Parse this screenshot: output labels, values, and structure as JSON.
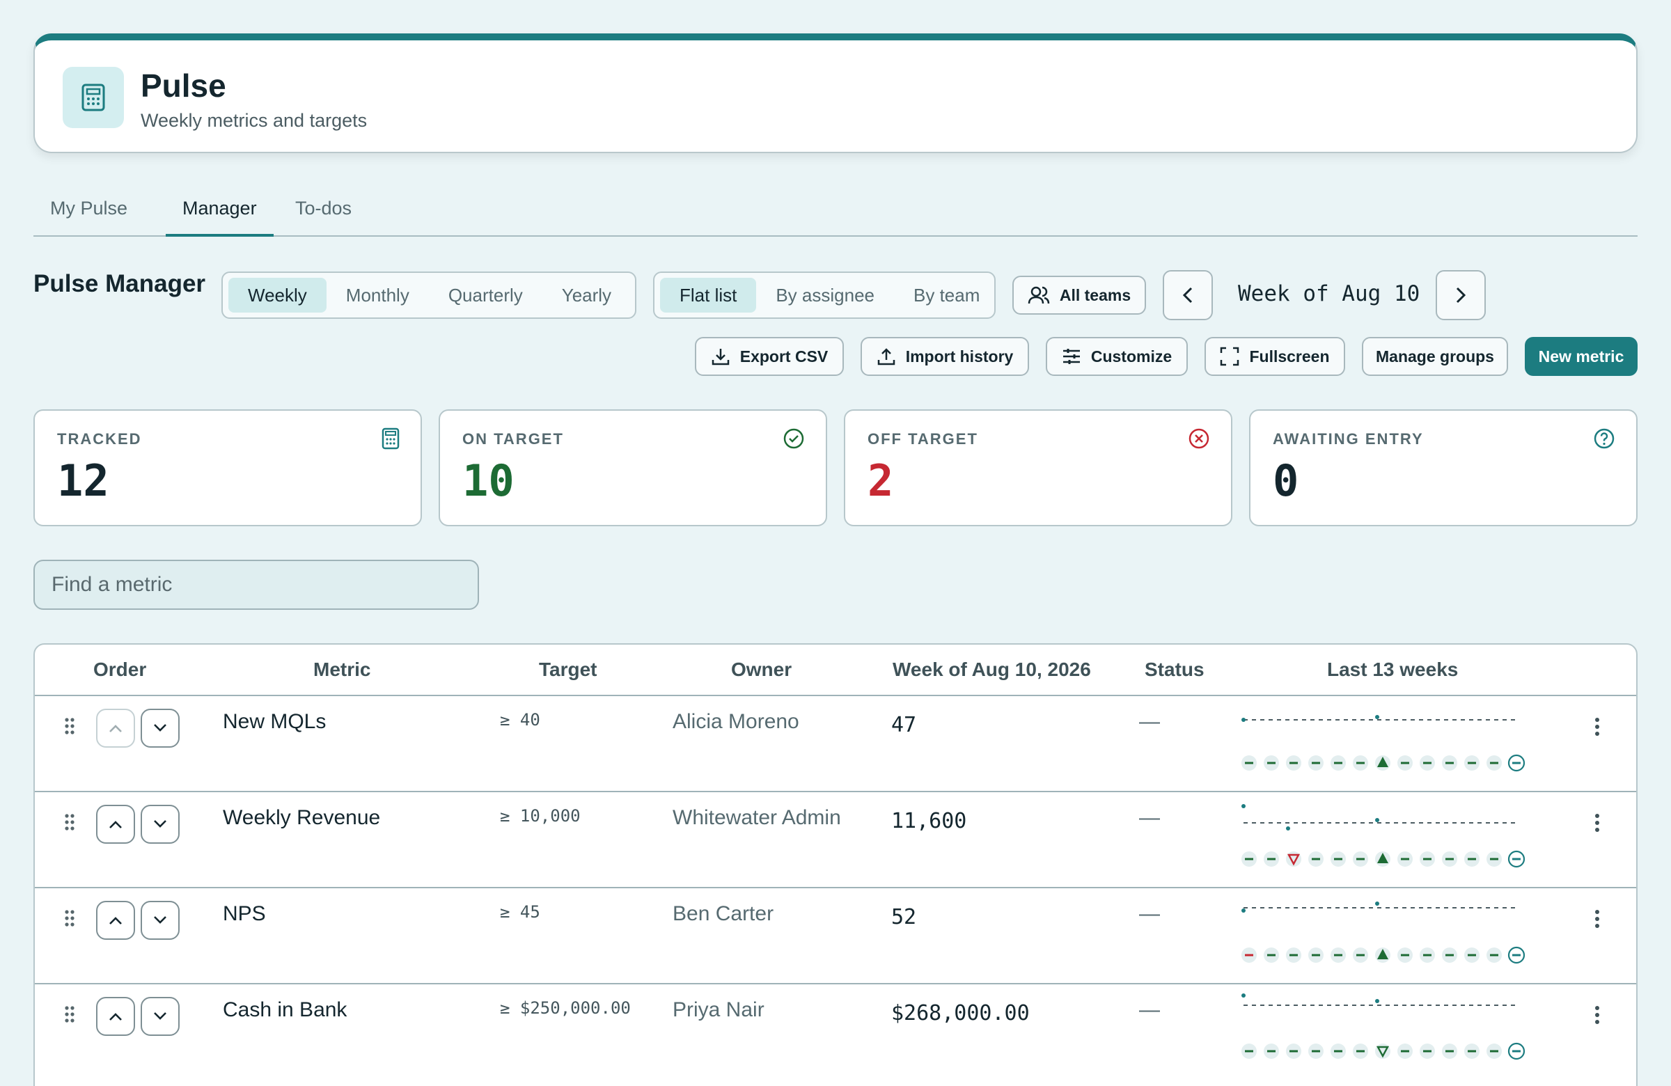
{
  "app": {
    "name": "Pulse",
    "subtitle": "Weekly metrics and targets",
    "icon": "calculator-icon"
  },
  "tabs": [
    {
      "label": "My Pulse",
      "active": false
    },
    {
      "label": "Manager",
      "active": true
    },
    {
      "label": "To-dos",
      "active": false
    }
  ],
  "page_title": "Pulse Manager",
  "periods": [
    {
      "label": "Weekly",
      "active": true
    },
    {
      "label": "Monthly",
      "active": false
    },
    {
      "label": "Quarterly",
      "active": false
    },
    {
      "label": "Yearly",
      "active": false
    }
  ],
  "views": [
    {
      "label": "Flat list",
      "active": true
    },
    {
      "label": "By assignee",
      "active": false
    },
    {
      "label": "By team",
      "active": false
    }
  ],
  "team_filter": {
    "label": "All teams",
    "icon": "users-icon"
  },
  "week_nav": {
    "label": "Week of Aug 10",
    "prev_icon": "chevron-left-icon",
    "next_icon": "chevron-right-icon"
  },
  "actions": {
    "export": "Export CSV",
    "import": "Import history",
    "customize": "Customize",
    "fullscreen": "Fullscreen",
    "manage_groups": "Manage groups",
    "new_metric": "New metric"
  },
  "stats": [
    {
      "label": "TRACKED",
      "value": "12",
      "icon": "calculator-icon",
      "color": "#14262e"
    },
    {
      "label": "ON TARGET",
      "value": "10",
      "icon": "check-circle-icon",
      "color": "#1d6b34"
    },
    {
      "label": "OFF TARGET",
      "value": "2",
      "icon": "x-circle-icon",
      "color": "#c62832"
    },
    {
      "label": "AWAITING ENTRY",
      "value": "0",
      "icon": "help-circle-icon",
      "color": "#14262e"
    }
  ],
  "search": {
    "placeholder": "Find a metric"
  },
  "table": {
    "headers": {
      "order": "Order",
      "metric": "Metric",
      "target": "Target",
      "owner": "Owner",
      "week": "Week of Aug 10, 2026",
      "status": "Status",
      "history": "Last 13 weeks"
    },
    "rows": [
      {
        "name": "New MQLs",
        "target": "≥ 40",
        "owner": "Alicia Moreno",
        "value": "47",
        "status": "—",
        "weeks": [
          "dash",
          "dash",
          "dash",
          "dash",
          "dash",
          "dash",
          "up",
          "dash",
          "dash",
          "dash",
          "dash",
          "dash",
          "current"
        ]
      },
      {
        "name": "Weekly Revenue",
        "target": "≥ 10,000",
        "owner": "Whitewater Admin",
        "value": "11,600",
        "status": "—",
        "weeks": [
          "dash",
          "dash",
          "down",
          "dash",
          "dash",
          "dash",
          "up",
          "dash",
          "dash",
          "dash",
          "dash",
          "dash",
          "current"
        ]
      },
      {
        "name": "NPS",
        "target": "≥ 45",
        "owner": "Ben Carter",
        "value": "52",
        "status": "—",
        "weeks": [
          "redDash",
          "dash",
          "dash",
          "dash",
          "dash",
          "dash",
          "up",
          "dash",
          "dash",
          "dash",
          "dash",
          "dash",
          "current"
        ]
      },
      {
        "name": "Cash in Bank",
        "target": "≥ $250,000.00",
        "owner": "Priya Nair",
        "value": "$268,000.00",
        "status": "—",
        "weeks": [
          "dash",
          "dash",
          "dash",
          "dash",
          "dash",
          "dash",
          "downGreen",
          "dash",
          "dash",
          "dash",
          "dash",
          "dash",
          "current"
        ]
      }
    ]
  },
  "colors": {
    "accent": "#1c7c80",
    "good": "#1d6b34",
    "bad": "#c62832"
  }
}
